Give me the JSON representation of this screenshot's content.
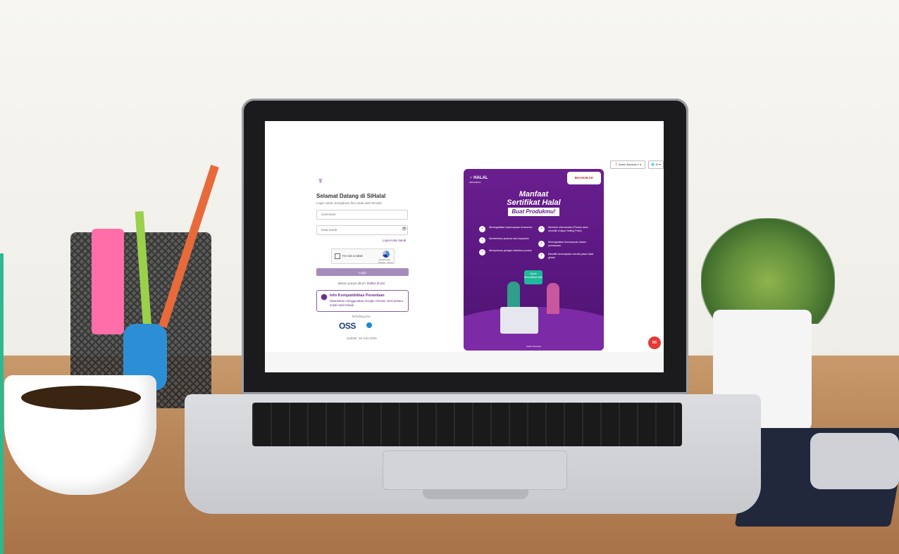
{
  "login": {
    "logo_icon": "halal-logo-icon",
    "welcome": "Selamat Datang di SiHalal",
    "subtitle": "Login untuk mengakses fitur pada web SiHalal",
    "username_placeholder": "Username",
    "password_placeholder": "Kata Sandi",
    "forgot_password": "Lupa Kata Sandi",
    "captcha_label": "I'm not a robot",
    "captcha_brand": "reCAPTCHA",
    "captcha_terms": "Privacy - Terms",
    "login_button": "Login",
    "register_prefix": "Belum punya akun?",
    "register_link": "Daftar di sini",
    "info_title": "Info Kompatibilitas Peramban",
    "info_body": "Disarankan menggunakan Google Chrome versi terbaru untuk hasil terbaik.",
    "connected_label": "Terhubung Ke:",
    "partner1": "OSS",
    "update_text": "Update: 26 Juni 2025"
  },
  "header": {
    "help_button": "Butuh Bantuan?",
    "language_button": "ID"
  },
  "poster": {
    "brand": "HALAL",
    "brand_sub": "INDONESIA",
    "akhlak": "BerAKHLAK",
    "title_line1": "Manfaat",
    "title_line2": "Sertifikat Halal",
    "title_line3": "Buat Produkmu!",
    "items": [
      "Meningkatkan kepercayaan konsumen",
      "Memberikan jaminan dan kepastian",
      "Memperluas jaringan distribusi produk",
      "Memberi nilai tambah (Produk akan memiliki Unique Selling Point)",
      "Meningkatkan kemampuan dalam pemasaran",
      "Memiliki kesempatan meraih pasar halal global"
    ],
    "bubble": "Sudah Bersertifikat Halal",
    "footer": "Halal Indonesia"
  },
  "colors": {
    "brand_purple": "#6a2c8c",
    "login_button": "#a58dbb",
    "chat_red": "#e53935"
  }
}
